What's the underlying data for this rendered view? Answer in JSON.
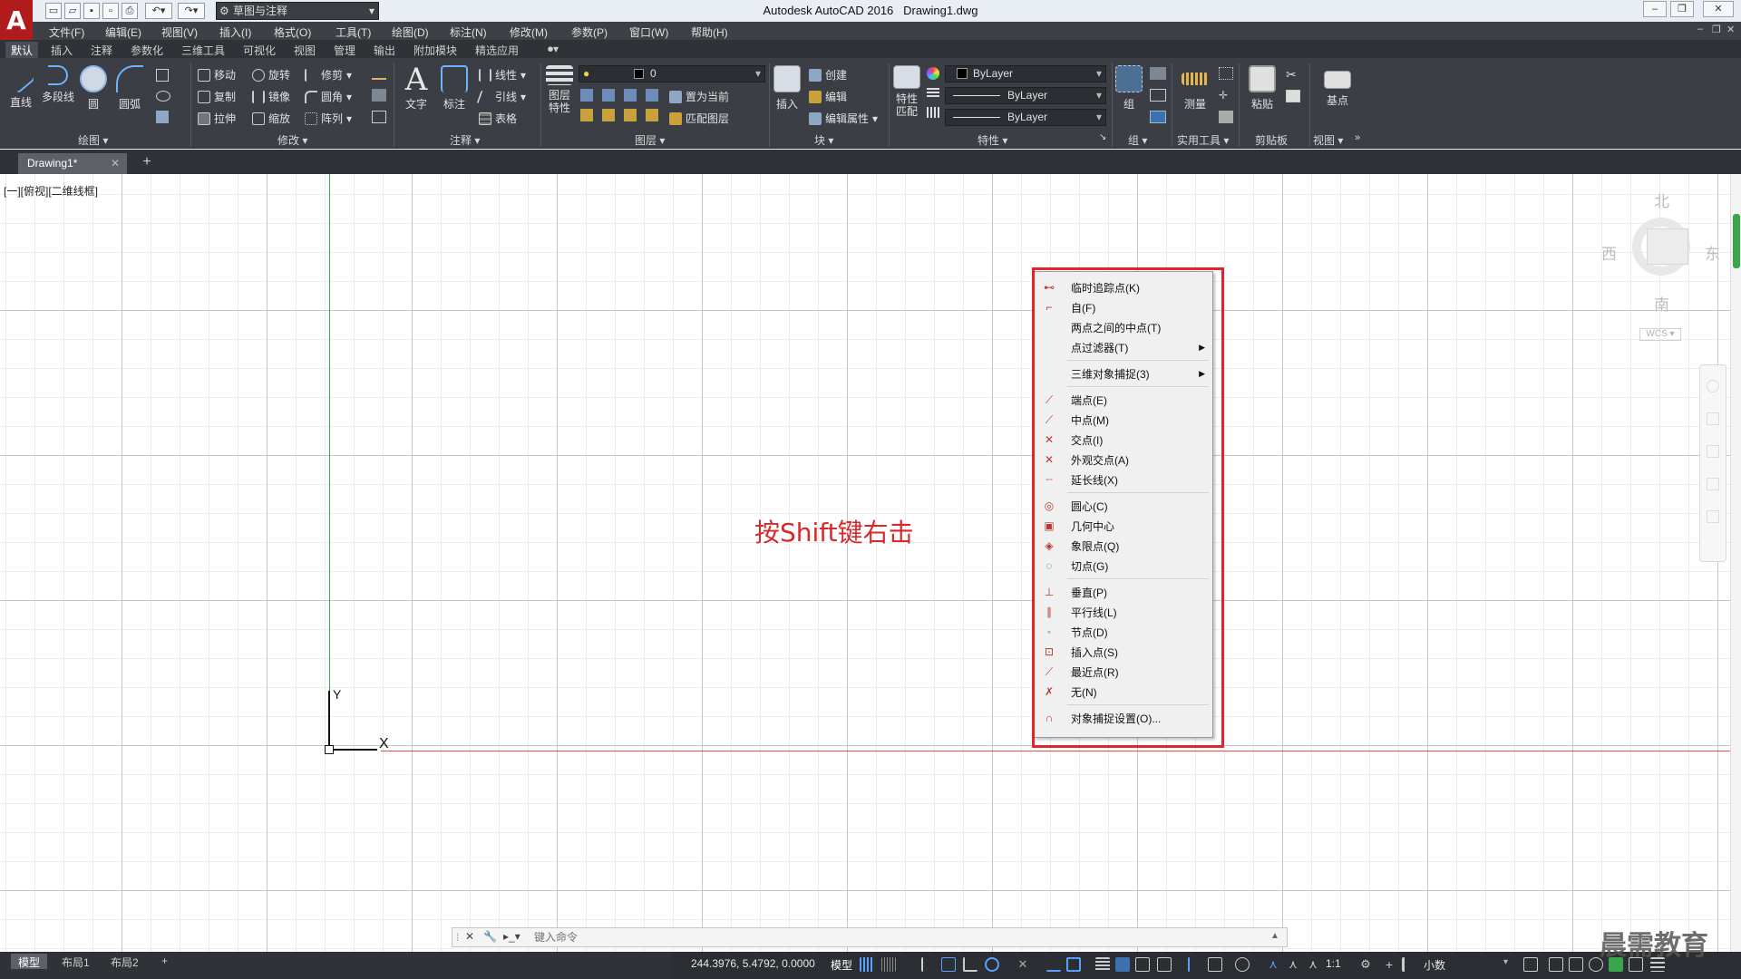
{
  "window": {
    "title": "Autodesk AutoCAD 2016",
    "filename": "Drawing1.dwg",
    "logo_letter": "A",
    "workspace": "草图与注释",
    "controls": [
      "‒",
      "❐",
      "✕"
    ]
  },
  "menu": [
    "文件(F)",
    "编辑(E)",
    "视图(V)",
    "插入(I)",
    "格式(O)",
    "工具(T)",
    "绘图(D)",
    "标注(N)",
    "修改(M)",
    "参数(P)",
    "窗口(W)",
    "帮助(H)"
  ],
  "ribbon_tabs": [
    "默认",
    "插入",
    "注释",
    "参数化",
    "三维工具",
    "可视化",
    "视图",
    "管理",
    "输出",
    "附加模块",
    "精选应用"
  ],
  "ribbon": {
    "draw": {
      "title": "绘图",
      "buttons": [
        "直线",
        "多段线",
        "圆",
        "圆弧"
      ]
    },
    "modify": {
      "title": "修改",
      "items": [
        "移动",
        "旋转",
        "修剪",
        "复制",
        "镜像",
        "圆角",
        "拉伸",
        "缩放",
        "阵列"
      ]
    },
    "annotation": {
      "title": "注释",
      "buttons": [
        "文字",
        "标注"
      ],
      "items": [
        "线性",
        "引线",
        "表格"
      ]
    },
    "layers": {
      "title": "图层",
      "button": "图层\n特性",
      "layer_value": "0",
      "items": [
        "置为当前",
        "匹配图层"
      ]
    },
    "block": {
      "title": "块",
      "button": "插入",
      "items": [
        "创建",
        "编辑",
        "编辑属性"
      ]
    },
    "properties": {
      "title": "特性",
      "button": "特性\n匹配",
      "color": "ByLayer",
      "linetype": "ByLayer",
      "lineweight": "ByLayer"
    },
    "groups": {
      "title": "组",
      "button": "组"
    },
    "utilities": {
      "title": "实用工具",
      "button": "测量"
    },
    "clipboard": {
      "title": "剪贴板",
      "button": "粘贴"
    },
    "view": {
      "title": "视图",
      "button": "基点"
    }
  },
  "document_tab": "Drawing1*",
  "viewport_label": "[一][俯视][二维线框]",
  "viewcube": {
    "north": "北",
    "south": "南",
    "east": "东",
    "west": "西",
    "wcs": "WCS"
  },
  "ucs": {
    "x": "X",
    "y": "Y"
  },
  "context_menu": [
    {
      "label": "临时追踪点(K)",
      "icon": "temp-track-icon",
      "glyph": "⊷"
    },
    {
      "label": "自(F)",
      "icon": "from-icon",
      "glyph": "⌐"
    },
    {
      "label": "两点之间的中点(T)",
      "icon": "",
      "glyph": ""
    },
    {
      "label": "点过滤器(T)",
      "icon": "",
      "glyph": "",
      "submenu": true
    },
    {
      "sep": true
    },
    {
      "label": "三维对象捕捉(3)",
      "icon": "",
      "glyph": "",
      "submenu": true
    },
    {
      "sep": true
    },
    {
      "label": "端点(E)",
      "icon": "endpoint-icon",
      "glyph": "⟋"
    },
    {
      "label": "中点(M)",
      "icon": "midpoint-icon",
      "glyph": "⟋"
    },
    {
      "label": "交点(I)",
      "icon": "intersection-icon",
      "glyph": "✕"
    },
    {
      "label": "外观交点(A)",
      "icon": "apparent-intersection-icon",
      "glyph": "✕"
    },
    {
      "label": "延长线(X)",
      "icon": "extension-icon",
      "glyph": "┈"
    },
    {
      "sep": true
    },
    {
      "label": "圆心(C)",
      "icon": "center-icon",
      "glyph": "◎"
    },
    {
      "label": "几何中心",
      "icon": "geometric-center-icon",
      "glyph": "▣"
    },
    {
      "label": "象限点(Q)",
      "icon": "quadrant-icon",
      "glyph": "◈"
    },
    {
      "label": "切点(G)",
      "icon": "tangent-icon",
      "glyph": "◌"
    },
    {
      "sep": true
    },
    {
      "label": "垂直(P)",
      "icon": "perpendicular-icon",
      "glyph": "⊥"
    },
    {
      "label": "平行线(L)",
      "icon": "parallel-icon",
      "glyph": "∥"
    },
    {
      "label": "节点(D)",
      "icon": "node-icon",
      "glyph": "◦"
    },
    {
      "label": "插入点(S)",
      "icon": "insertion-icon",
      "glyph": "⊡"
    },
    {
      "label": "最近点(R)",
      "icon": "nearest-icon",
      "glyph": "⟋"
    },
    {
      "label": "无(N)",
      "icon": "none-icon",
      "glyph": "✗"
    },
    {
      "sep": true
    },
    {
      "label": "对象捕捉设置(O)...",
      "icon": "osnap-settings-icon",
      "glyph": "∩"
    }
  ],
  "annotation": "按Shift键右击",
  "command_line": {
    "placeholder": "键入命令"
  },
  "layout_tabs": [
    "模型",
    "布局1",
    "布局2"
  ],
  "status": {
    "coords": "244.3976, 5.4792, 0.0000",
    "mode": "模型",
    "scale": "1:1",
    "units": "小数"
  },
  "watermark": "晨需教育",
  "colors": {
    "accent_red": "#e3242b",
    "y_axis": "#3aa64c",
    "x_axis": "#e05050"
  }
}
